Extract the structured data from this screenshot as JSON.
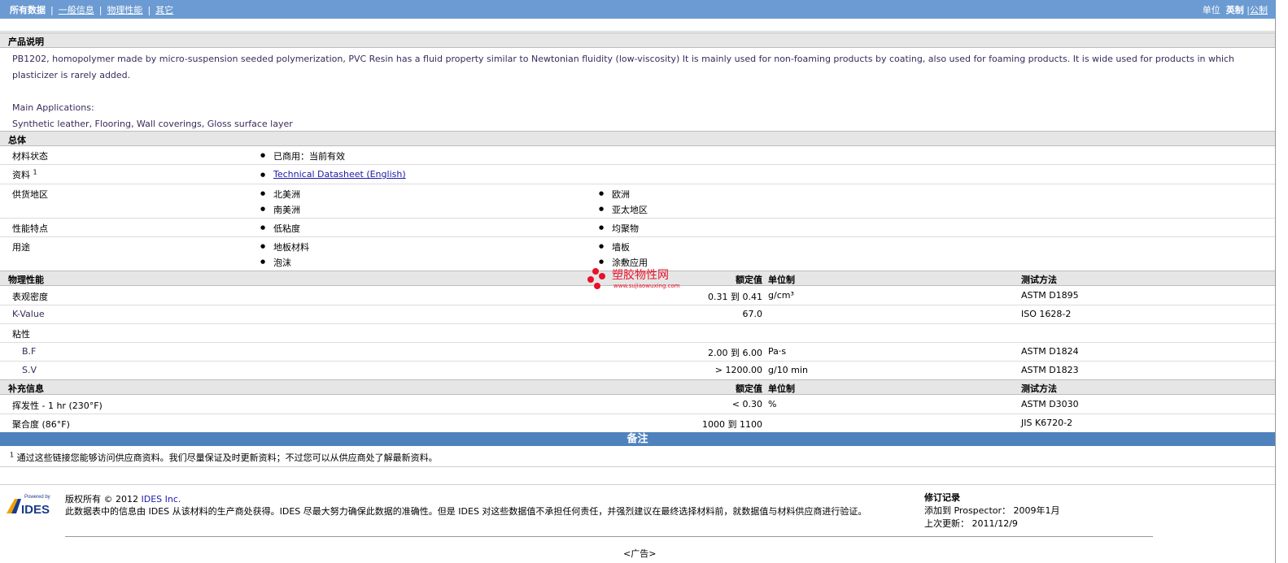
{
  "topnav": {
    "all_data": "所有数据",
    "general_info": "一般信息",
    "physical": "物理性能",
    "other": "其它",
    "units_label": "单位",
    "units_english": "英制",
    "units_metric": "公制"
  },
  "product_desc": {
    "header": "产品说明",
    "line1": "PB1202, homopolymer made by micro-suspension seeded polymerization, PVC Resin has a fluid property similar to Newtonian fluidity (low-viscosity) It is mainly used for non-foaming products by coating, also used for foaming products. It is wide used for products in which plasticizer is rarely added.",
    "apps_label": "Main Applications:",
    "apps": "Synthetic leather, Flooring, Wall coverings, Gloss surface layer"
  },
  "general": {
    "header": "总体",
    "status_label": "材料状态",
    "status_value": "已商用：当前有效",
    "docs_label": "资料",
    "docs_sup": "1",
    "docs_link": "Technical Datasheet (English)",
    "region_label": "供货地区",
    "regions": [
      "北美洲",
      "欧洲",
      "南美洲",
      "亚太地区"
    ],
    "features_label": "性能特点",
    "features": [
      "低粘度",
      "均聚物"
    ],
    "uses_label": "用途",
    "uses": [
      "地板材料",
      "墙板",
      "泡沫",
      "涂敷应用"
    ]
  },
  "physical": {
    "header": "物理性能",
    "col_value": "额定值",
    "col_unit": "单位制",
    "col_method": "测试方法",
    "rows": [
      {
        "label": "表观密度",
        "value": "0.31 到  0.41",
        "unit": "g/cm³",
        "method": "ASTM D1895"
      },
      {
        "label": "K-Value",
        "value": "67.0",
        "unit": "",
        "method": "ISO 1628-2"
      },
      {
        "label": "粘性",
        "value": "",
        "unit": "",
        "method": ""
      },
      {
        "label": "B.F",
        "value": "2.00 到  6.00",
        "unit": "Pa·s",
        "method": "ASTM D1824"
      },
      {
        "label": "S.V",
        "value": "> 1200.00",
        "unit": "g/10 min",
        "method": "ASTM D1823"
      }
    ]
  },
  "supplemental": {
    "header": "补充信息",
    "col_value": "额定值",
    "col_unit": "单位制",
    "col_method": "测试方法",
    "rows": [
      {
        "label": "挥发性  - 1 hr (230°F)",
        "value": "< 0.30",
        "unit": "%",
        "method": "ASTM D3030"
      },
      {
        "label": "聚合度  (86°F)",
        "value": "1000 到  1100",
        "unit": "",
        "method": "JIS K6720-2"
      }
    ]
  },
  "notes": {
    "header": "备注",
    "sup": "1",
    "text": "通过这些链接您能够访问供应商资料。我们尽量保证及时更新资料；不过您可以从供应商处了解最新资料。"
  },
  "footer": {
    "logo_top": "Powered by",
    "logo_text": "IDES",
    "copyright": "版权所有 © 2012",
    "ides_link": "IDES Inc.",
    "disclaimer": "此数据表中的信息由  IDES 从该材料的生产商处获得。IDES 尽最大努力确保此数据的准确性。但是  IDES 对这些数据值不承担任何责任，并强烈建议在最终选择材料前，就数据值与材料供应商进行验证。",
    "rev_title": "修订记录",
    "added_label": "添加到  Prospector：",
    "added_value": "2009年1月",
    "updated_label": "上次更新：",
    "updated_value": "2011/12/9",
    "ad": "<广告>"
  },
  "watermark": {
    "text": "塑胶物性网",
    "url": "www.sujiaowuxing.com"
  }
}
